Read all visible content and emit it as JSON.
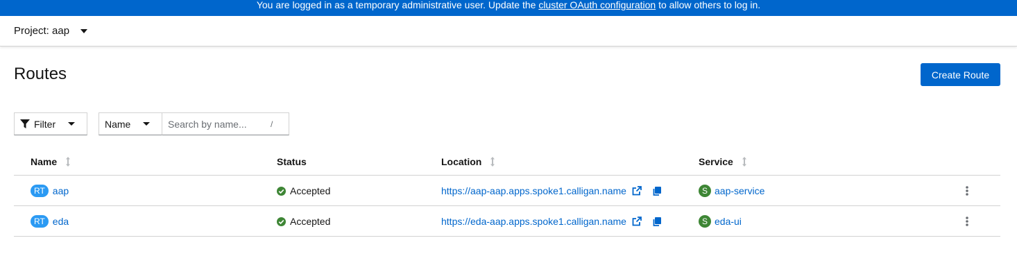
{
  "banner": {
    "text_before": "You are logged in as a temporary administrative user. Update the ",
    "link": "cluster OAuth configuration",
    "text_after": " to allow others to log in."
  },
  "project": {
    "label": "Project: aap"
  },
  "page": {
    "title": "Routes",
    "create_button": "Create Route"
  },
  "toolbar": {
    "filter_label": "Filter",
    "name_select": "Name",
    "search_placeholder": "Search by name...",
    "search_shortcut": "/"
  },
  "table": {
    "columns": {
      "name": "Name",
      "status": "Status",
      "location": "Location",
      "service": "Service"
    },
    "rows": [
      {
        "badge": "RT",
        "name": "aap",
        "status": "Accepted",
        "location": "https://aap-aap.apps.spoke1.calligan.name",
        "service_badge": "S",
        "service": "aap-service"
      },
      {
        "badge": "RT",
        "name": "eda",
        "status": "Accepted",
        "location": "https://eda-aap.apps.spoke1.calligan.name",
        "service_badge": "S",
        "service": "eda-ui"
      }
    ]
  },
  "colors": {
    "brand": "#0066cc",
    "route_badge": "#2b9af3",
    "service_badge": "#3e8635",
    "status_ok": "#3e8635"
  }
}
